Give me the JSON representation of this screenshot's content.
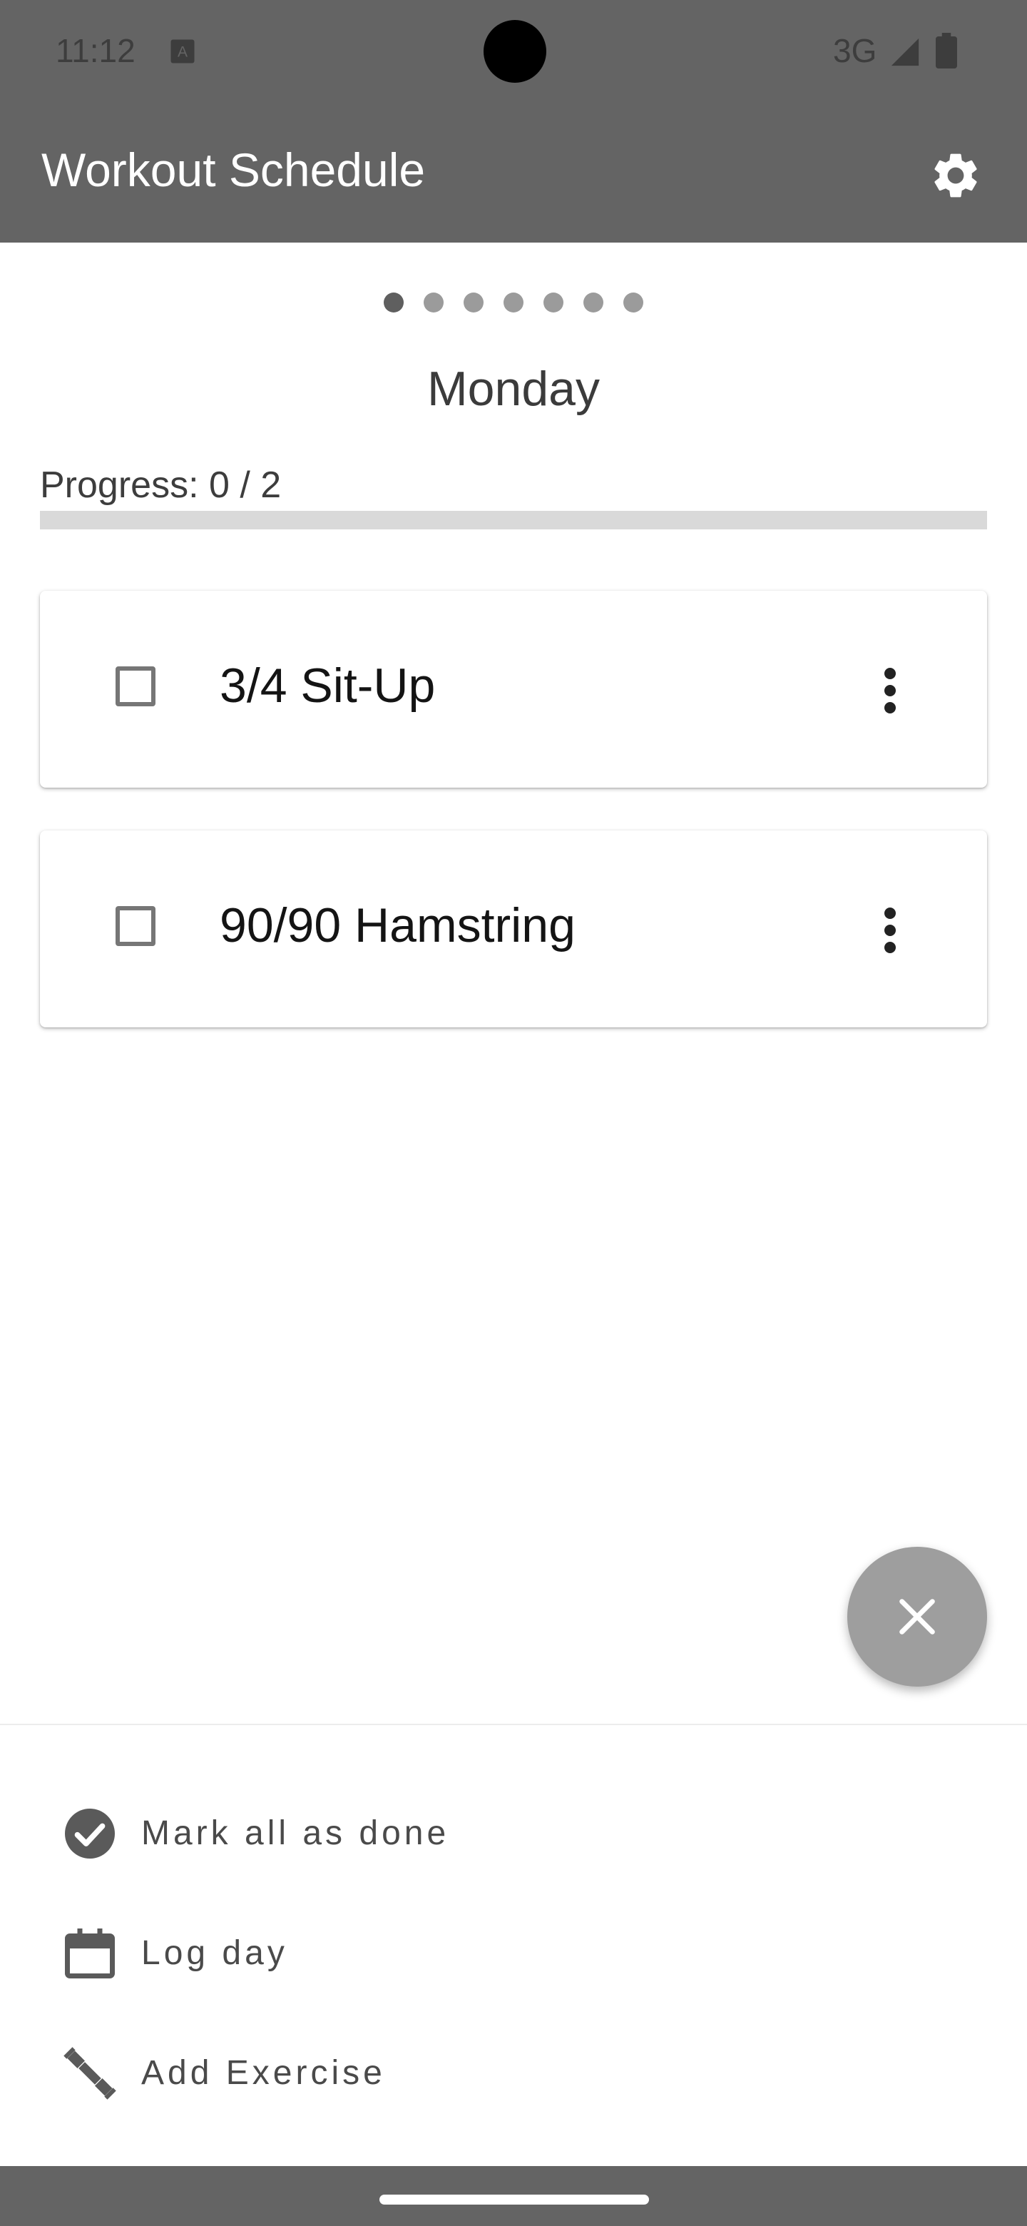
{
  "status_bar": {
    "time": "11:12",
    "network": "3G",
    "icons": [
      "keyboard-a-icon",
      "signal-icon",
      "battery-icon"
    ]
  },
  "app_bar": {
    "title": "Workout Schedule",
    "settings_icon": "gear-icon"
  },
  "pager": {
    "total_pages": 7,
    "active_index": 0
  },
  "day": {
    "title": "Monday"
  },
  "progress": {
    "label": "Progress: 0 / 2",
    "done": 0,
    "total": 2
  },
  "exercises": [
    {
      "name": "3/4 Sit-Up",
      "checked": false
    },
    {
      "name": "90/90 Hamstring",
      "checked": false
    }
  ],
  "fab": {
    "icon": "close-icon"
  },
  "actions": [
    {
      "label": "Mark all as done",
      "icon": "check-circle-icon"
    },
    {
      "label": "Log day",
      "icon": "calendar-icon"
    },
    {
      "label": "Add Exercise",
      "icon": "dumbbell-icon"
    }
  ],
  "colors": {
    "app_bar": "#646464",
    "fab": "#9e9e9e",
    "progress_track": "#d9d9d9"
  }
}
